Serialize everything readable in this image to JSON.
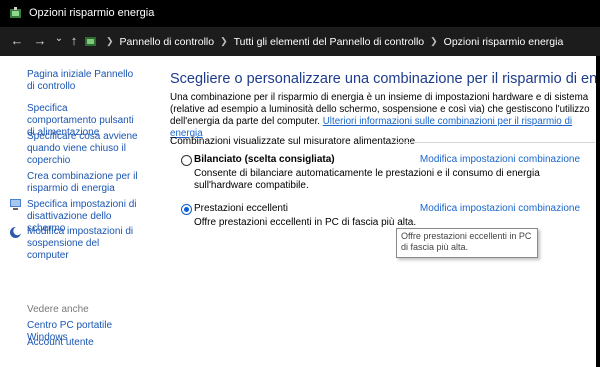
{
  "window": {
    "title": "Opzioni risparmio energia"
  },
  "address": {
    "crumbs": [
      "Pannello di controllo",
      "Tutti gli elementi del Pannello di controllo",
      "Opzioni risparmio energia"
    ]
  },
  "nav": {
    "back": "←",
    "forward": "→",
    "dropdown": "⌄",
    "up": "↑"
  },
  "sidebar": {
    "items": [
      {
        "label": "Pagina iniziale Pannello di controllo"
      },
      {
        "label": "Specifica comportamento pulsanti di alimentazione"
      },
      {
        "label": "Specificare cosa avviene quando viene chiuso il coperchio"
      },
      {
        "label": "Crea combinazione per il risparmio di energia"
      },
      {
        "label": "Specifica impostazioni di disattivazione dello schermo"
      },
      {
        "label": "Modifica impostazioni di sospensione del computer"
      }
    ],
    "see_also_label": "Vedere anche",
    "see_also": [
      {
        "label": "Centro PC portatile Windows"
      },
      {
        "label": "Account utente"
      }
    ]
  },
  "main": {
    "heading": "Scegliere o personalizzare una combinazione per il risparmio di energia",
    "description": "Una combinazione per il risparmio di energia è un insieme di impostazioni hardware e di sistema (relative ad esempio a luminosità dello schermo, sospensione e così via) che gestiscono l'utilizzo dell'energia da parte del computer. ",
    "more_info_link": "Ulteriori informazioni sulle combinazioni per il risparmio di energia",
    "group_label": "Combinazioni visualizzate sul misuratore alimentazione",
    "plans": [
      {
        "name": "Bilanciato (scelta consigliata)",
        "selected": false,
        "link": "Modifica impostazioni combinazione",
        "description": "Consente di bilanciare automaticamente le prestazioni e il consumo di energia sull'hardware compatibile."
      },
      {
        "name": "Prestazioni eccellenti",
        "selected": true,
        "link": "Modifica impostazioni combinazione",
        "description": "Offre prestazioni eccellenti in PC di fascia più alta."
      }
    ],
    "tooltip": "Offre prestazioni eccellenti in PC di fascia più alta."
  },
  "colors": {
    "link": "#1a55b2",
    "heading": "#1e3c8c",
    "titlebar": "#000000",
    "addressbar": "#1c1c1c"
  },
  "icons": {
    "app": "power-options-icon",
    "shield": "shield-icon",
    "moon": "moon-icon"
  }
}
